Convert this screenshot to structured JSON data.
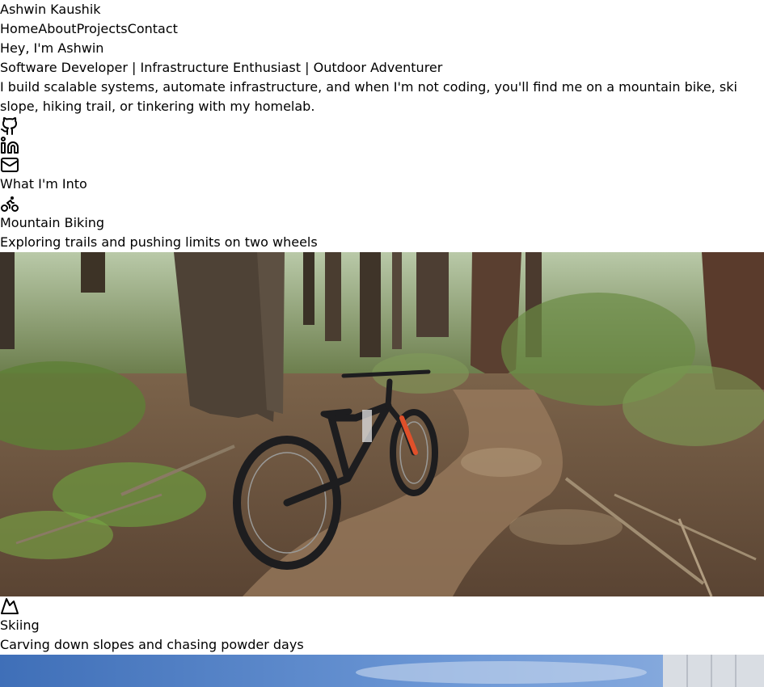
{
  "site": {
    "name": "Ashwin Kaushik"
  },
  "nav": {
    "items": [
      "Home",
      "About",
      "Projects",
      "Contact"
    ]
  },
  "hero": {
    "greeting": "Hey, I'm Ashwin",
    "tagline": "Software Developer | Infrastructure Enthusiast | Outdoor Adventurer",
    "intro": "I build scalable systems, automate infrastructure, and when I'm not coding, you'll find me on a mountain bike, ski slope, hiking trail, or tinkering with my homelab."
  },
  "social": {
    "icons": [
      "github-icon",
      "linkedin-icon",
      "mail-icon"
    ]
  },
  "interests": {
    "heading": "What I'm Into",
    "items": [
      {
        "icon": "bike-icon",
        "title": "Mountain Biking",
        "description": "Exploring trails and pushing limits on two wheels"
      },
      {
        "icon": "mountain-icon",
        "title": "Skiing",
        "description": "Carving down slopes and chasing powder days"
      }
    ]
  },
  "colors": {
    "text": "#000000",
    "background": "#ffffff",
    "forest_dark": "#3b3a2a",
    "trail": "#8a6a4c",
    "foliage": "#5f8a3a",
    "bike_accent": "#e0502a",
    "sky": "#5a86c8"
  }
}
